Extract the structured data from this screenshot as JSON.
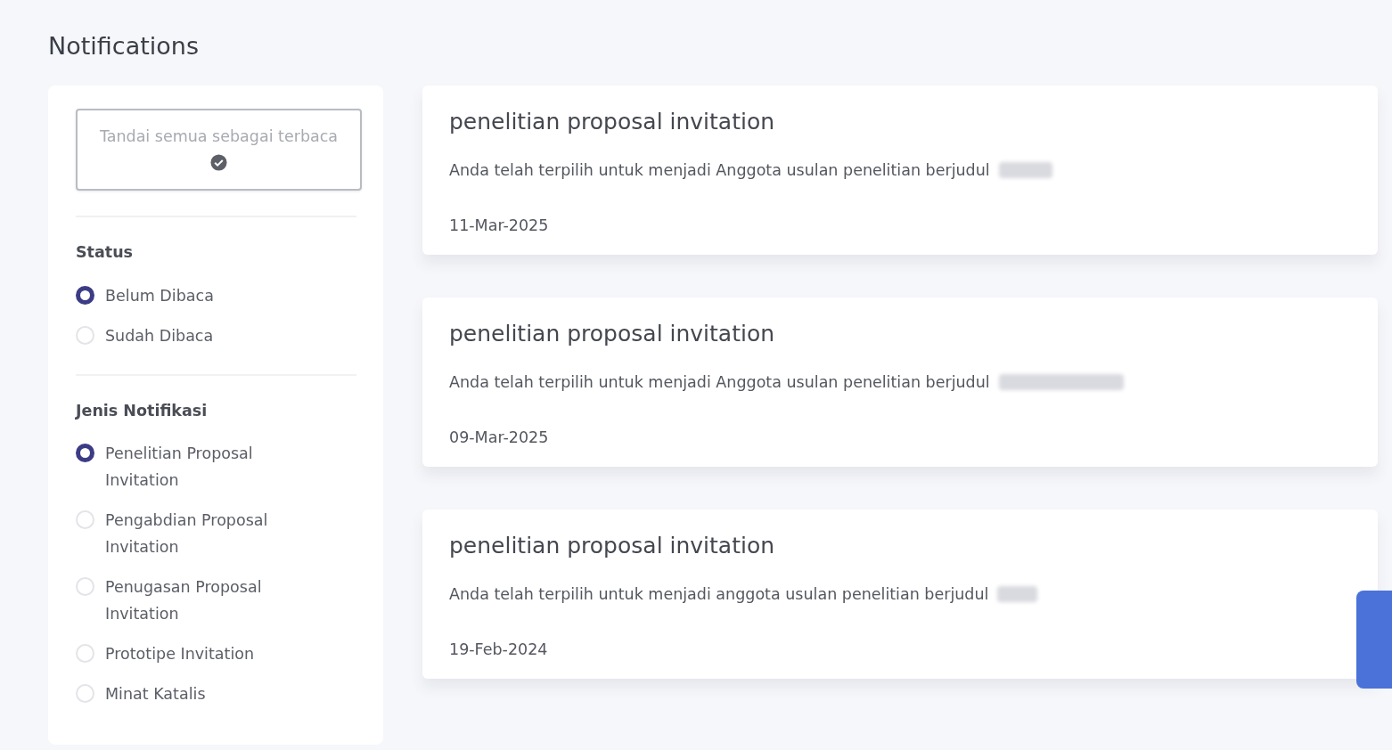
{
  "page": {
    "title": "Notifications"
  },
  "sidebar": {
    "mark_all_button": "Tandai semua sebagai terbaca",
    "filters": [
      {
        "heading": "Status",
        "options": [
          {
            "label": "Belum Dibaca",
            "selected": true
          },
          {
            "label": "Sudah Dibaca",
            "selected": false
          }
        ]
      },
      {
        "heading": "Jenis Notifikasi",
        "options": [
          {
            "label": "Penelitian Proposal Invitation",
            "selected": true
          },
          {
            "label": "Pengabdian Proposal Invitation",
            "selected": false
          },
          {
            "label": "Penugasan Proposal Invitation",
            "selected": false
          },
          {
            "label": "Prototipe Invitation",
            "selected": false
          },
          {
            "label": "Minat Katalis",
            "selected": false
          }
        ]
      }
    ]
  },
  "notifications": [
    {
      "title": "penelitian proposal invitation",
      "message": "Anda telah terpilih untuk menjadi Anggota usulan penelitian berjudul",
      "date": "11-Mar-2025"
    },
    {
      "title": "penelitian proposal invitation",
      "message": "Anda telah terpilih untuk menjadi Anggota usulan penelitian berjudul",
      "date": "09-Mar-2025"
    },
    {
      "title": "penelitian proposal invitation",
      "message": "Anda telah terpilih untuk menjadi anggota usulan penelitian berjudul",
      "date": "19-Feb-2024"
    }
  ]
}
